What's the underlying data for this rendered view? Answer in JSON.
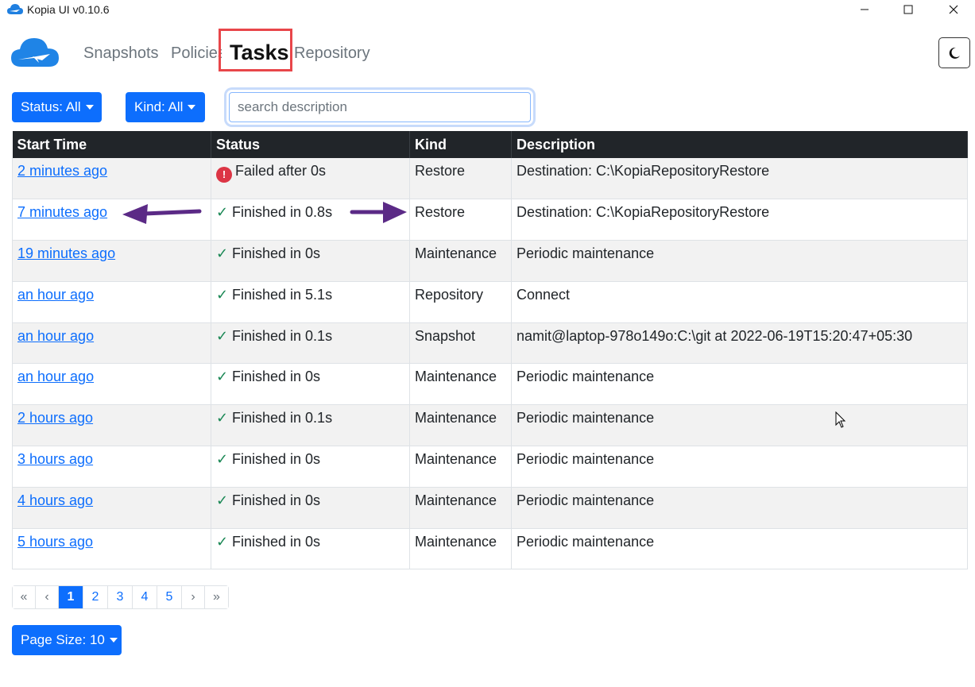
{
  "window": {
    "title": "Kopia UI v0.10.6",
    "minimize_glyph": "—",
    "maximize_glyph": "☐",
    "close_glyph": "✕"
  },
  "nav": {
    "items": [
      {
        "label": "Snapshots"
      },
      {
        "label": "Policies"
      },
      {
        "label": "Tasks"
      },
      {
        "label": "Repository"
      }
    ],
    "active": "Tasks",
    "theme_icon": "moon-icon"
  },
  "filters": {
    "status_label": "Status: All",
    "kind_label": "Kind: All",
    "search_placeholder": "search description",
    "search_value": ""
  },
  "table": {
    "headers": [
      "Start Time",
      "Status",
      "Kind",
      "Description"
    ],
    "rows": [
      {
        "start_time": "2 minutes ago",
        "status": "Failed after 0s",
        "state": "failed",
        "kind": "Restore",
        "description": "Destination: C:\\KopiaRepositoryRestore"
      },
      {
        "start_time": "7 minutes ago",
        "status": "Finished in 0.8s",
        "state": "ok",
        "kind": "Restore",
        "description": "Destination: C:\\KopiaRepositoryRestore"
      },
      {
        "start_time": "19 minutes ago",
        "status": "Finished in 0s",
        "state": "ok",
        "kind": "Maintenance",
        "description": "Periodic maintenance"
      },
      {
        "start_time": "an hour ago",
        "status": "Finished in 5.1s",
        "state": "ok",
        "kind": "Repository",
        "description": "Connect"
      },
      {
        "start_time": "an hour ago",
        "status": "Finished in 0.1s",
        "state": "ok",
        "kind": "Snapshot",
        "description": "namit@laptop-978o149o:C:\\git at 2022-06-19T15:20:47+05:30"
      },
      {
        "start_time": "an hour ago",
        "status": "Finished in 0s",
        "state": "ok",
        "kind": "Maintenance",
        "description": "Periodic maintenance"
      },
      {
        "start_time": "2 hours ago",
        "status": "Finished in 0.1s",
        "state": "ok",
        "kind": "Maintenance",
        "description": "Periodic maintenance"
      },
      {
        "start_time": "3 hours ago",
        "status": "Finished in 0s",
        "state": "ok",
        "kind": "Maintenance",
        "description": "Periodic maintenance"
      },
      {
        "start_time": "4 hours ago",
        "status": "Finished in 0s",
        "state": "ok",
        "kind": "Maintenance",
        "description": "Periodic maintenance"
      },
      {
        "start_time": "5 hours ago",
        "status": "Finished in 0s",
        "state": "ok",
        "kind": "Maintenance",
        "description": "Periodic maintenance"
      }
    ]
  },
  "pagination": {
    "first": "«",
    "prev": "‹",
    "pages": [
      "1",
      "2",
      "3",
      "4",
      "5"
    ],
    "current": "1",
    "next": "›",
    "last": "»"
  },
  "page_size_label": "Page Size: 10",
  "colors": {
    "primary": "#0d6efd",
    "header_bg": "#212529",
    "success": "#198754",
    "danger": "#dc3545",
    "highlight": "#e8464a",
    "annotation_arrow": "#5b2a86"
  }
}
